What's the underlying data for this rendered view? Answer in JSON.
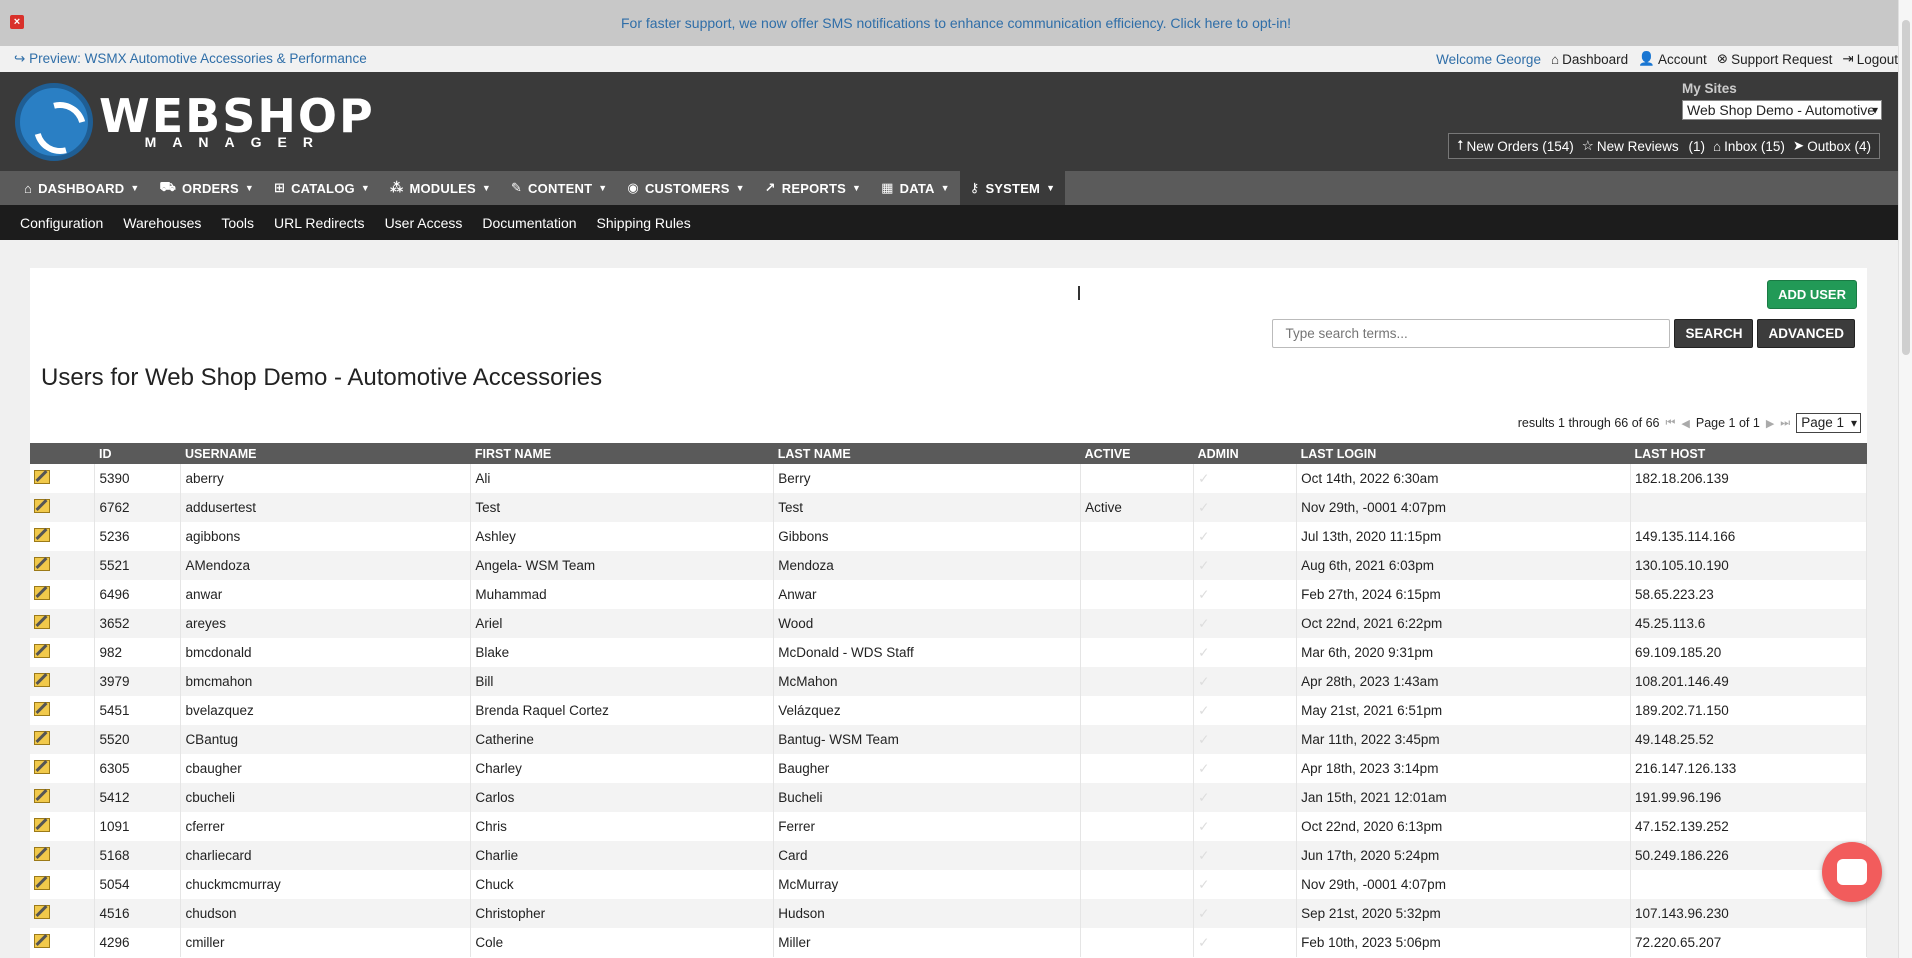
{
  "banner": {
    "text": "For faster support, we now offer SMS notifications to enhance communication efficiency. Click here to opt-in!",
    "close": "×"
  },
  "topbar": {
    "preview": "Preview: WSMX Automotive Accessories & Performance",
    "welcome": "Welcome George",
    "links": [
      "Dashboard",
      "Account",
      "Support Request",
      "Logout"
    ]
  },
  "logo": {
    "big": "WEBSHOP",
    "small": "MANAGER"
  },
  "mysites": {
    "label": "My Sites",
    "value": "Web Shop Demo - Automotive"
  },
  "counters": {
    "new_orders": "New Orders (154)",
    "new_reviews": "New Reviews",
    "new_reviews_count": "(1)",
    "inbox": "Inbox (15)",
    "outbox": "Outbox (4)"
  },
  "mainnav": [
    "DASHBOARD",
    "ORDERS",
    "CATALOG",
    "MODULES",
    "CONTENT",
    "CUSTOMERS",
    "REPORTS",
    "DATA",
    "SYSTEM"
  ],
  "subnav": [
    "Configuration",
    "Warehouses",
    "Tools",
    "URL Redirects",
    "User Access",
    "Documentation",
    "Shipping Rules"
  ],
  "actions": {
    "add_user": "ADD USER",
    "search_placeholder": "Type search terms...",
    "search": "SEARCH",
    "advanced": "ADVANCED"
  },
  "page_title": "Users for Web Shop Demo - Automotive Accessories",
  "pager": {
    "results": "results 1 through 66 of 66",
    "page_of": "Page 1 of 1",
    "select": "Page 1"
  },
  "columns": [
    "",
    "ID",
    "USERNAME",
    "FIRST NAME",
    "LAST NAME",
    "ACTIVE",
    "ADMIN",
    "LAST LOGIN",
    "LAST HOST"
  ],
  "rows": [
    {
      "id": "5390",
      "username": "aberry",
      "first": "Ali",
      "last": "Berry",
      "active": "",
      "login": "Oct 14th, 2022 6:30am",
      "host": "182.18.206.139"
    },
    {
      "id": "6762",
      "username": "addusertest",
      "first": "Test",
      "last": "Test",
      "active": "Active",
      "login": "Nov 29th, -0001 4:07pm",
      "host": ""
    },
    {
      "id": "5236",
      "username": "agibbons",
      "first": "Ashley",
      "last": "Gibbons",
      "active": "",
      "login": "Jul 13th, 2020 11:15pm",
      "host": "149.135.114.166"
    },
    {
      "id": "5521",
      "username": "AMendoza",
      "first": "Angela- WSM Team",
      "last": "Mendoza",
      "active": "",
      "login": "Aug 6th, 2021 6:03pm",
      "host": "130.105.10.190"
    },
    {
      "id": "6496",
      "username": "anwar",
      "first": "Muhammad",
      "last": "Anwar",
      "active": "",
      "login": "Feb 27th, 2024 6:15pm",
      "host": "58.65.223.23"
    },
    {
      "id": "3652",
      "username": "areyes",
      "first": "Ariel",
      "last": "Wood",
      "active": "",
      "login": "Oct 22nd, 2021 6:22pm",
      "host": "45.25.113.6"
    },
    {
      "id": "982",
      "username": "bmcdonald",
      "first": "Blake",
      "last": "McDonald - WDS Staff",
      "active": "",
      "login": "Mar 6th, 2020 9:31pm",
      "host": "69.109.185.20"
    },
    {
      "id": "3979",
      "username": "bmcmahon",
      "first": "Bill",
      "last": "McMahon",
      "active": "",
      "login": "Apr 28th, 2023 1:43am",
      "host": "108.201.146.49"
    },
    {
      "id": "5451",
      "username": "bvelazquez",
      "first": "Brenda Raquel Cortez",
      "last": "Velázquez",
      "active": "",
      "login": "May 21st, 2021 6:51pm",
      "host": "189.202.71.150"
    },
    {
      "id": "5520",
      "username": "CBantug",
      "first": "Catherine",
      "last": "Bantug- WSM Team",
      "active": "",
      "login": "Mar 11th, 2022 3:45pm",
      "host": "49.148.25.52"
    },
    {
      "id": "6305",
      "username": "cbaugher",
      "first": "Charley",
      "last": "Baugher",
      "active": "",
      "login": "Apr 18th, 2023 3:14pm",
      "host": "216.147.126.133"
    },
    {
      "id": "5412",
      "username": "cbucheli",
      "first": "Carlos",
      "last": "Bucheli",
      "active": "",
      "login": "Jan 15th, 2021 12:01am",
      "host": "191.99.96.196"
    },
    {
      "id": "1091",
      "username": "cferrer",
      "first": "Chris",
      "last": "Ferrer",
      "active": "",
      "login": "Oct 22nd, 2020 6:13pm",
      "host": "47.152.139.252"
    },
    {
      "id": "5168",
      "username": "charliecard",
      "first": "Charlie",
      "last": "Card",
      "active": "",
      "login": "Jun 17th, 2020 5:24pm",
      "host": "50.249.186.226"
    },
    {
      "id": "5054",
      "username": "chuckmcmurray",
      "first": "Chuck",
      "last": "McMurray",
      "active": "",
      "login": "Nov 29th, -0001 4:07pm",
      "host": ""
    },
    {
      "id": "4516",
      "username": "chudson",
      "first": "Christopher",
      "last": "Hudson",
      "active": "",
      "login": "Sep 21st, 2020 5:32pm",
      "host": "107.143.96.230"
    },
    {
      "id": "4296",
      "username": "cmiller",
      "first": "Cole",
      "last": "Miller",
      "active": "",
      "login": "Feb 10th, 2023 5:06pm",
      "host": "72.220.65.207"
    }
  ]
}
